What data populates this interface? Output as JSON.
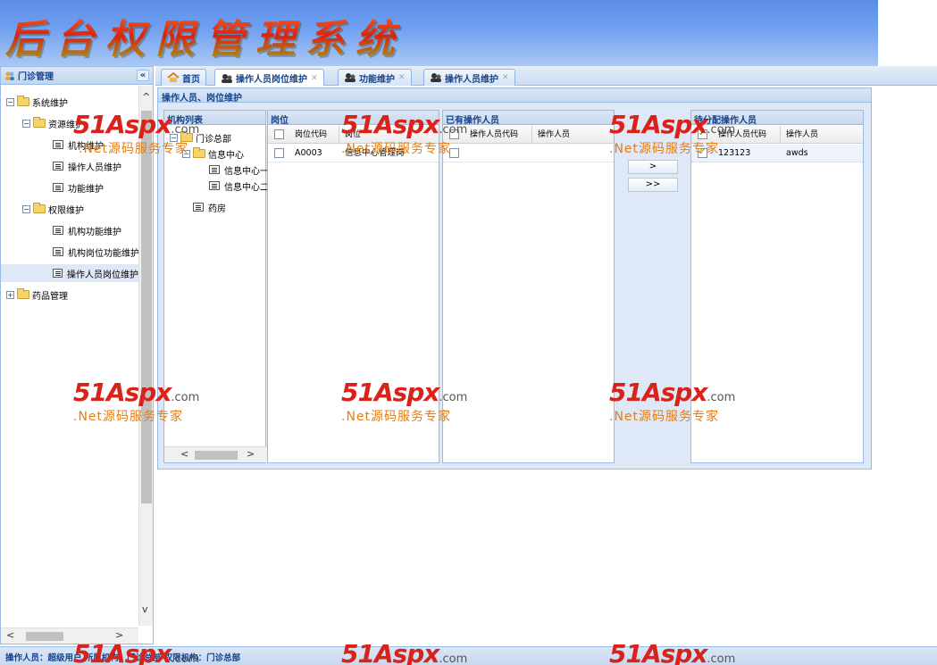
{
  "header": {
    "title": "后台权限管理系统"
  },
  "west": {
    "title": "门诊管理",
    "collapse_icon": "«",
    "tree": [
      {
        "label": "系统维护",
        "level": 0,
        "type": "folder",
        "expanded": true
      },
      {
        "label": "资源维护",
        "level": 1,
        "type": "folder",
        "expanded": true
      },
      {
        "label": "机构维护",
        "level": 2,
        "type": "leaf"
      },
      {
        "label": "操作人员维护",
        "level": 2,
        "type": "leaf"
      },
      {
        "label": "功能维护",
        "level": 2,
        "type": "leaf"
      },
      {
        "label": "权限维护",
        "level": 1,
        "type": "folder",
        "expanded": true
      },
      {
        "label": "机构功能维护",
        "level": 2,
        "type": "leaf"
      },
      {
        "label": "机构岗位功能维护",
        "level": 2,
        "type": "leaf"
      },
      {
        "label": "操作人员岗位维护",
        "level": 2,
        "type": "leaf",
        "selected": true
      },
      {
        "label": "药品管理",
        "level": 0,
        "type": "folder",
        "expanded": false
      }
    ]
  },
  "tabs": [
    {
      "label": "首页",
      "closable": false
    },
    {
      "label": "操作人员岗位维护",
      "closable": true,
      "active": true
    },
    {
      "label": "功能维护",
      "closable": true
    },
    {
      "label": "操作人员维护",
      "closable": true
    }
  ],
  "panel": {
    "title": "操作人员、岗位维护",
    "org": {
      "title": "机构列表",
      "tree": [
        {
          "label": "门诊总部",
          "level": 0,
          "type": "folder"
        },
        {
          "label": "信息中心",
          "level": 1,
          "type": "folder"
        },
        {
          "label": "信息中心一",
          "level": 2,
          "type": "leaf"
        },
        {
          "label": "信息中心二",
          "level": 2,
          "type": "leaf"
        },
        {
          "label": "药房",
          "level": 1,
          "type": "leaf"
        }
      ]
    },
    "posts": {
      "title": "岗位",
      "columns": [
        "岗位代码",
        "岗位"
      ],
      "rows": [
        {
          "code": "A0003",
          "name": "信息中心管理岗",
          "checked": false
        }
      ]
    },
    "assigned": {
      "title": "已有操作人员",
      "columns": [
        "操作人员代码",
        "操作人员"
      ],
      "rows": [
        {
          "code": "",
          "name": "",
          "checked": false
        }
      ]
    },
    "buttons": {
      "move_one": ">",
      "move_all": ">>"
    },
    "pending": {
      "title": "待分配操作人员",
      "columns": [
        "操作人员代码",
        "操作人员"
      ],
      "rows": [
        {
          "code": "123123",
          "name": "awds",
          "checked": true
        }
      ]
    }
  },
  "footer": {
    "text": "操作人员：超级用户   所属机构：门诊总部   权限机构：门诊总部"
  },
  "watermark": {
    "brand": "51Aspx",
    "domain": ".com",
    "slogan": ".Net源码服务专家"
  }
}
